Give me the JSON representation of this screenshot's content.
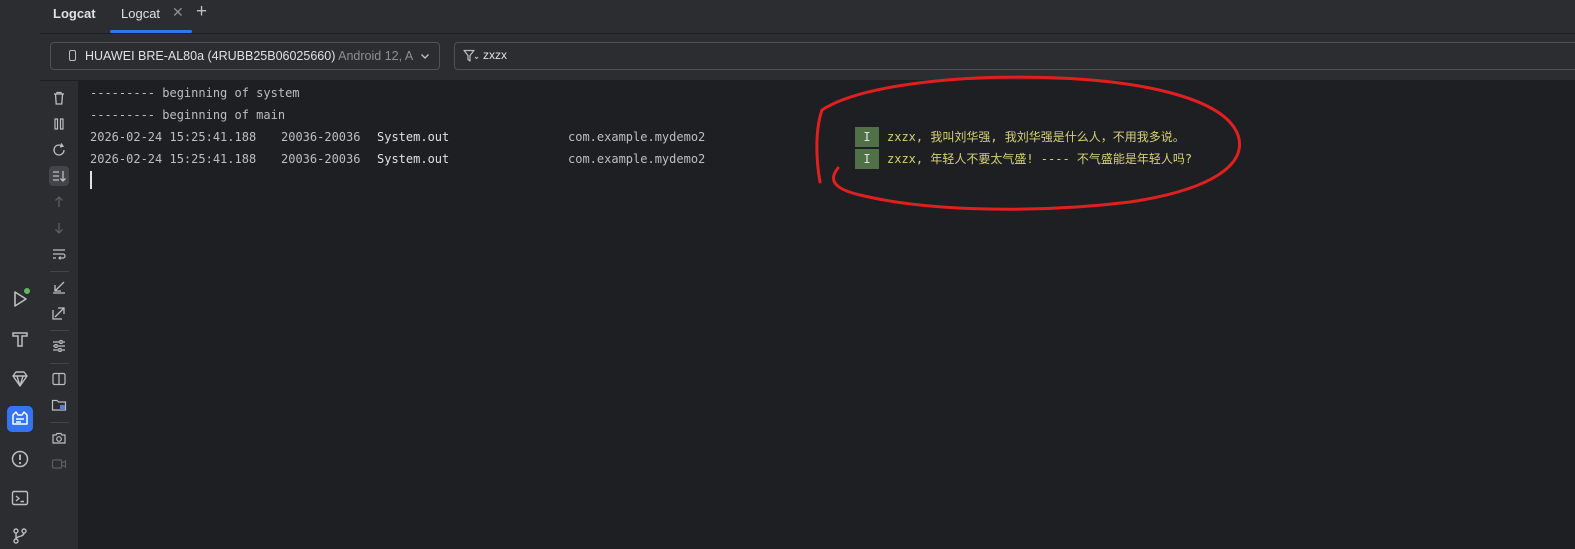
{
  "tabs": {
    "tool_title": "Logcat",
    "active_tab": "Logcat",
    "close_glyph": "✕",
    "add_glyph": "+"
  },
  "device_selector": {
    "device": "HUAWEI BRE-AL80a (4RUBB25B06025660)",
    "detail": " Android 12, A"
  },
  "filter": {
    "value": "zxzx"
  },
  "log": {
    "header_lines": [
      "--------- beginning of system",
      "--------- beginning of main"
    ],
    "entries": [
      {
        "datetime": "2026-02-24 15:25:41.188",
        "pid_tid": "20036-20036",
        "tag": "System.out",
        "package": "com.example.mydemo2",
        "level": "I",
        "message": "zxzx, 我叫刘华强, 我刘华强是什么人，不用我多说。"
      },
      {
        "datetime": "2026-02-24 15:25:41.188",
        "pid_tid": "20036-20036",
        "tag": "System.out",
        "package": "com.example.mydemo2",
        "level": "I",
        "message": "zxzx, 年轻人不要太气盛! ---- 不气盛能是年轻人吗?"
      }
    ]
  },
  "icons": {
    "rail": [
      "run-icon",
      "build-hammer-icon",
      "gem-icon",
      "logcat-icon",
      "problems-icon",
      "terminal-icon",
      "git-branch-icon"
    ],
    "strip": [
      "clear-logcat-icon",
      "pause-icon",
      "restart-icon",
      "scroll-to-end-icon",
      "up-arrow-icon",
      "down-arrow-icon",
      "soft-wrap-icon",
      "import-icon",
      "export-icon",
      "settings-sliders-icon",
      "split-panels-icon",
      "device-explorer-icon",
      "screenshot-icon",
      "screen-record-icon"
    ]
  },
  "colors": {
    "background": "#1e1f22",
    "panel": "#2b2d30",
    "accent": "#3574f0",
    "info_level": "#507047",
    "message_text": "#d4d17a",
    "annotation_circle": "#e02020"
  }
}
